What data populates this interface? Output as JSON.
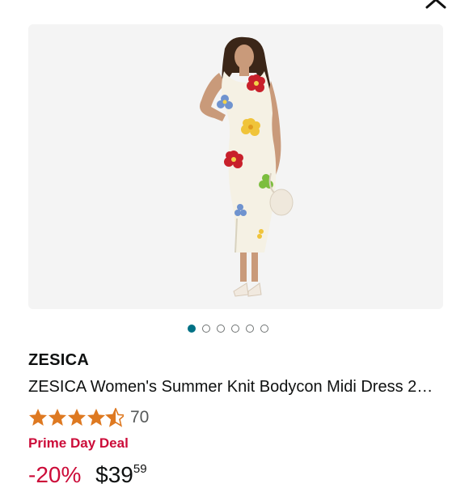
{
  "close": {
    "icon": "close-icon"
  },
  "product": {
    "image_icon": "product-photo",
    "brand": "ZESICA",
    "title": "ZESICA Women's Summer Knit Bodycon Midi Dress 2…",
    "rating": {
      "value": 4.5,
      "max": 5,
      "count": "70"
    },
    "deal_label": "Prime Day Deal",
    "discount": "-20%",
    "price": "$39",
    "price_cents": "59"
  },
  "carousel": {
    "total": 6,
    "active_index": 0
  },
  "colors": {
    "deal_red": "#cc0c39",
    "star_orange": "#de7921",
    "dot_active": "#007185"
  }
}
